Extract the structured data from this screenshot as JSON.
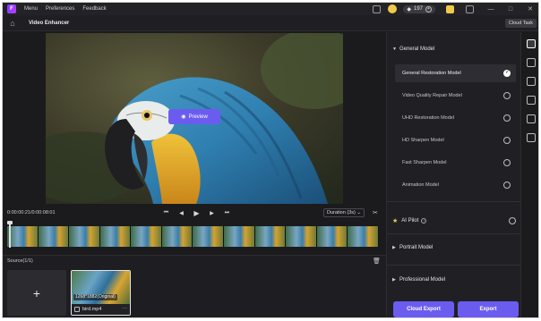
{
  "app": {
    "logo_letter": "F",
    "menu": [
      "Menu",
      "Preferences",
      "Feedback"
    ],
    "credits": "197",
    "window_buttons": [
      "—",
      "□",
      "✕"
    ]
  },
  "header": {
    "title": "Video Enhancer",
    "cloud_task": "Cloud Task"
  },
  "preview": {
    "button_label": "Preview"
  },
  "player": {
    "timecode": "0:00:00:21/0:00:08:01",
    "controls": [
      "⏮",
      "◀",
      "▶",
      "▶",
      "⏭"
    ],
    "duration_label": "Duration (3s)",
    "duration_caret": "⌄"
  },
  "source": {
    "label": "Source(1/1)",
    "add_symbol": "+",
    "file": {
      "resolution": "1268*1882(Original)",
      "name": "bird.mp4",
      "more": "···"
    }
  },
  "models": {
    "general_title": "General Model",
    "items": [
      {
        "label": "General Restoration Model",
        "selected": true
      },
      {
        "label": "Video Quality Repair Model",
        "selected": false
      },
      {
        "label": "UHD Restoration Model",
        "selected": false
      },
      {
        "label": "HD Sharpen Model",
        "selected": false
      },
      {
        "label": "Fast Sharpen Model",
        "selected": false
      },
      {
        "label": "Animation Model",
        "selected": false
      }
    ],
    "ai_pilot": "AI Pilot",
    "portrait_title": "Portrait Model",
    "professional_title": "Professional Model"
  },
  "actions": {
    "cloud_export": "Cloud Export",
    "export": "Export"
  },
  "colors": {
    "accent": "#6b5cf0",
    "background": "#1b1b1e",
    "panel": "#202024",
    "star": "#f2c94c"
  }
}
